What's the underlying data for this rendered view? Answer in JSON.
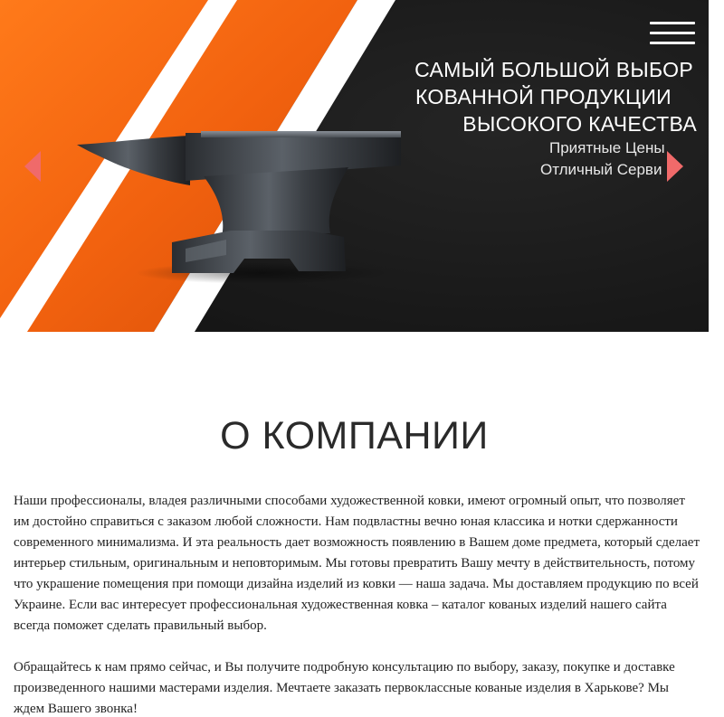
{
  "hero": {
    "headline_line1": "САМЫЙ БОЛЬШОЙ ВЫБОР",
    "headline_line2": "КОВАННОЙ ПРОДУКЦИИ",
    "headline_line3": "ВЫСОКОГО КАЧЕСТВА",
    "subline_line1": "Приятные Цены",
    "subline_line2": "Отличный Серви",
    "colors": {
      "orange": "#f2620f",
      "dark": "#1c1c1c",
      "stripe": "#ffffff",
      "arrow": "#f06a6a"
    },
    "icons": {
      "menu": "hamburger-menu-icon",
      "prev": "chevron-left-icon",
      "next": "chevron-right-icon",
      "image": "anvil-illustration"
    }
  },
  "about": {
    "title": "О КОМПАНИИ",
    "paragraph1": "Наши профессионалы, владея различными способами художественной ковки, имеют огромный опыт, что позволяет им достойно справиться с заказом любой сложности. Нам подвластны вечно юная классика и нотки сдержанности современного минимализма. И эта реальность дает возможность появлению в Вашем доме предмета, который сделает интерьер стильным, оригинальным и неповторимым. Мы готовы превратить Вашу мечту в действительность, потому что украшение помещения при помощи дизайна изделий из ковки — наша задача. Мы доставляем продукцию по всей Украине. Если вас интересует профессиональная художественная ковка – каталог кованых изделий нашего сайта всегда поможет сделать правильный выбор.",
    "paragraph2": "Обращайтесь к нам прямо сейчас, и Вы получите подробную консультацию по выбору, заказу, покупке и доставке произведенного нашими мастерами изделия. Мечтаете заказать первоклассные кованые изделия в Харькове? Мы ждем Вашего звонка!"
  }
}
